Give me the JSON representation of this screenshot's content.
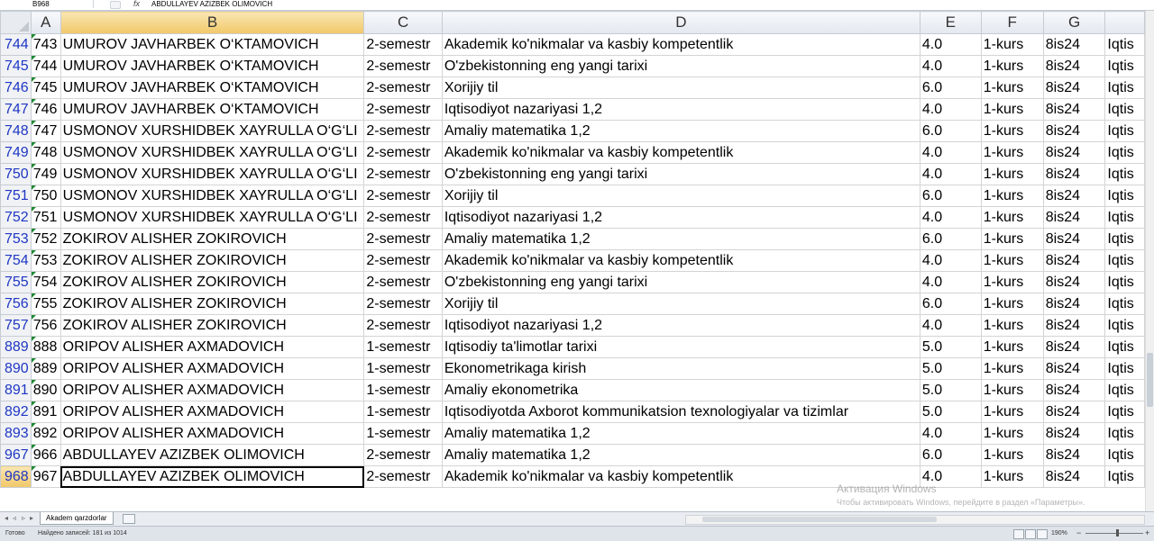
{
  "formula_bar": {
    "name_box": "B968",
    "fx": "fx",
    "content": "ABDULLAYEV AZIZBEK OLIMOVICH"
  },
  "columns": [
    "A",
    "B",
    "C",
    "D",
    "E",
    "F",
    "G",
    ""
  ],
  "rows": [
    {
      "row": "744",
      "a": "743",
      "b": "UMUROV JAVHARBEK O‘KTAMOVICH",
      "c": "2-semestr",
      "d": "Akademik ko'nikmalar va kasbiy kompetentlik",
      "e": "4.0",
      "f": "1-kurs",
      "g": "8is24",
      "h": "Iqtis"
    },
    {
      "row": "745",
      "a": "744",
      "b": "UMUROV JAVHARBEK O‘KTAMOVICH",
      "c": "2-semestr",
      "d": "O'zbekistonning eng yangi tarixi",
      "e": "4.0",
      "f": "1-kurs",
      "g": "8is24",
      "h": "Iqtis"
    },
    {
      "row": "746",
      "a": "745",
      "b": "UMUROV JAVHARBEK O‘KTAMOVICH",
      "c": "2-semestr",
      "d": "Xorijiy til",
      "e": "6.0",
      "f": "1-kurs",
      "g": "8is24",
      "h": "Iqtis"
    },
    {
      "row": "747",
      "a": "746",
      "b": "UMUROV JAVHARBEK O‘KTAMOVICH",
      "c": "2-semestr",
      "d": "Iqtisodiyot nazariyasi 1,2",
      "e": "4.0",
      "f": "1-kurs",
      "g": "8is24",
      "h": "Iqtis"
    },
    {
      "row": "748",
      "a": "747",
      "b": "USMONOV XURSHIDBEK XAYRULLA O‘G‘LI",
      "c": "2-semestr",
      "d": "Amaliy matematika 1,2",
      "e": "6.0",
      "f": "1-kurs",
      "g": "8is24",
      "h": "Iqtis"
    },
    {
      "row": "749",
      "a": "748",
      "b": "USMONOV XURSHIDBEK XAYRULLA O‘G‘LI",
      "c": "2-semestr",
      "d": "Akademik ko'nikmalar va kasbiy kompetentlik",
      "e": "4.0",
      "f": "1-kurs",
      "g": "8is24",
      "h": "Iqtis"
    },
    {
      "row": "750",
      "a": "749",
      "b": "USMONOV XURSHIDBEK XAYRULLA O‘G‘LI",
      "c": "2-semestr",
      "d": "O'zbekistonning eng yangi tarixi",
      "e": "4.0",
      "f": "1-kurs",
      "g": "8is24",
      "h": "Iqtis"
    },
    {
      "row": "751",
      "a": "750",
      "b": "USMONOV XURSHIDBEK XAYRULLA O‘G‘LI",
      "c": "2-semestr",
      "d": "Xorijiy til",
      "e": "6.0",
      "f": "1-kurs",
      "g": "8is24",
      "h": "Iqtis"
    },
    {
      "row": "752",
      "a": "751",
      "b": "USMONOV XURSHIDBEK XAYRULLA O‘G‘LI",
      "c": "2-semestr",
      "d": "Iqtisodiyot nazariyasi 1,2",
      "e": "4.0",
      "f": "1-kurs",
      "g": "8is24",
      "h": "Iqtis"
    },
    {
      "row": "753",
      "a": "752",
      "b": "ZOKIROV ALISHER ZOKIROVICH",
      "c": "2-semestr",
      "d": "Amaliy matematika 1,2",
      "e": "6.0",
      "f": "1-kurs",
      "g": "8is24",
      "h": "Iqtis"
    },
    {
      "row": "754",
      "a": "753",
      "b": "ZOKIROV ALISHER ZOKIROVICH",
      "c": "2-semestr",
      "d": "Akademik ko'nikmalar va kasbiy kompetentlik",
      "e": "4.0",
      "f": "1-kurs",
      "g": "8is24",
      "h": "Iqtis"
    },
    {
      "row": "755",
      "a": "754",
      "b": "ZOKIROV ALISHER ZOKIROVICH",
      "c": "2-semestr",
      "d": "O'zbekistonning eng yangi tarixi",
      "e": "4.0",
      "f": "1-kurs",
      "g": "8is24",
      "h": "Iqtis"
    },
    {
      "row": "756",
      "a": "755",
      "b": "ZOKIROV ALISHER ZOKIROVICH",
      "c": "2-semestr",
      "d": "Xorijiy til",
      "e": "6.0",
      "f": "1-kurs",
      "g": "8is24",
      "h": "Iqtis"
    },
    {
      "row": "757",
      "a": "756",
      "b": "ZOKIROV ALISHER ZOKIROVICH",
      "c": "2-semestr",
      "d": "Iqtisodiyot nazariyasi 1,2",
      "e": "4.0",
      "f": "1-kurs",
      "g": "8is24",
      "h": "Iqtis"
    },
    {
      "row": "889",
      "a": "888",
      "b": "ORIPOV ALISHER AXMADOVICH",
      "c": "1-semestr",
      "d": "Iqtisodiy ta'limotlar tarixi",
      "e": "5.0",
      "f": "1-kurs",
      "g": "8is24",
      "h": "Iqtis"
    },
    {
      "row": "890",
      "a": "889",
      "b": "ORIPOV ALISHER AXMADOVICH",
      "c": "1-semestr",
      "d": "Ekonometrikaga kirish",
      "e": "5.0",
      "f": "1-kurs",
      "g": "8is24",
      "h": "Iqtis"
    },
    {
      "row": "891",
      "a": "890",
      "b": "ORIPOV ALISHER AXMADOVICH",
      "c": "1-semestr",
      "d": "Amaliy ekonometrika",
      "e": "5.0",
      "f": "1-kurs",
      "g": "8is24",
      "h": "Iqtis"
    },
    {
      "row": "892",
      "a": "891",
      "b": "ORIPOV ALISHER AXMADOVICH",
      "c": "1-semestr",
      "d": "Iqtisodiyotda Axborot kommunikatsion texnologiyalar va tizimlar",
      "e": "5.0",
      "f": "1-kurs",
      "g": "8is24",
      "h": "Iqtis"
    },
    {
      "row": "893",
      "a": "892",
      "b": "ORIPOV ALISHER AXMADOVICH",
      "c": "1-semestr",
      "d": "Amaliy matematika 1,2",
      "e": "4.0",
      "f": "1-kurs",
      "g": "8is24",
      "h": "Iqtis"
    },
    {
      "row": "967",
      "a": "966",
      "b": "ABDULLAYEV AZIZBEK OLIMOVICH",
      "c": "2-semestr",
      "d": "Amaliy matematika 1,2",
      "e": "6.0",
      "f": "1-kurs",
      "g": "8is24",
      "h": "Iqtis"
    },
    {
      "row": "968",
      "a": "967",
      "b": "ABDULLAYEV AZIZBEK OLIMOVICH",
      "c": "2-semestr",
      "d": "Akademik ko'nikmalar va kasbiy kompetentlik",
      "e": "4.0",
      "f": "1-kurs",
      "g": "8is24",
      "h": "Iqtis",
      "active": true
    }
  ],
  "sheet_tab": "Akadem qarzdorlar",
  "status": {
    "ready": "Готово",
    "found": "Найдено записей: 181 из 1014",
    "zoom": "190%",
    "zoom_minus": "−",
    "zoom_plus": "+"
  },
  "watermark": {
    "line1": "Активация Windows",
    "line2": "Чтобы активировать Windows, перейдите в раздел «Параметры»."
  },
  "colors": {
    "row_header_text": "#1f37c4",
    "selected_header": "#f1c869",
    "filter_marker": "#1e8a34"
  }
}
